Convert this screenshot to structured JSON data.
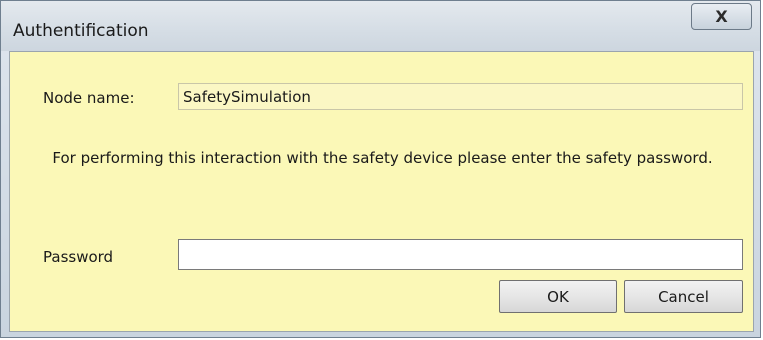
{
  "window": {
    "title": "Authentification",
    "close_glyph": "X"
  },
  "form": {
    "node_label": "Node name:",
    "node_value": "SafetySimulation",
    "message": "For performing this interaction with the safety device please enter the safety password.",
    "password_label": "Password",
    "password_value": ""
  },
  "buttons": {
    "ok_label": "OK",
    "cancel_label": "Cancel"
  },
  "colors": {
    "client_background": "#fbf8b7",
    "titlebar": "#d5dde5"
  },
  "icons": {
    "close": "close-icon"
  }
}
